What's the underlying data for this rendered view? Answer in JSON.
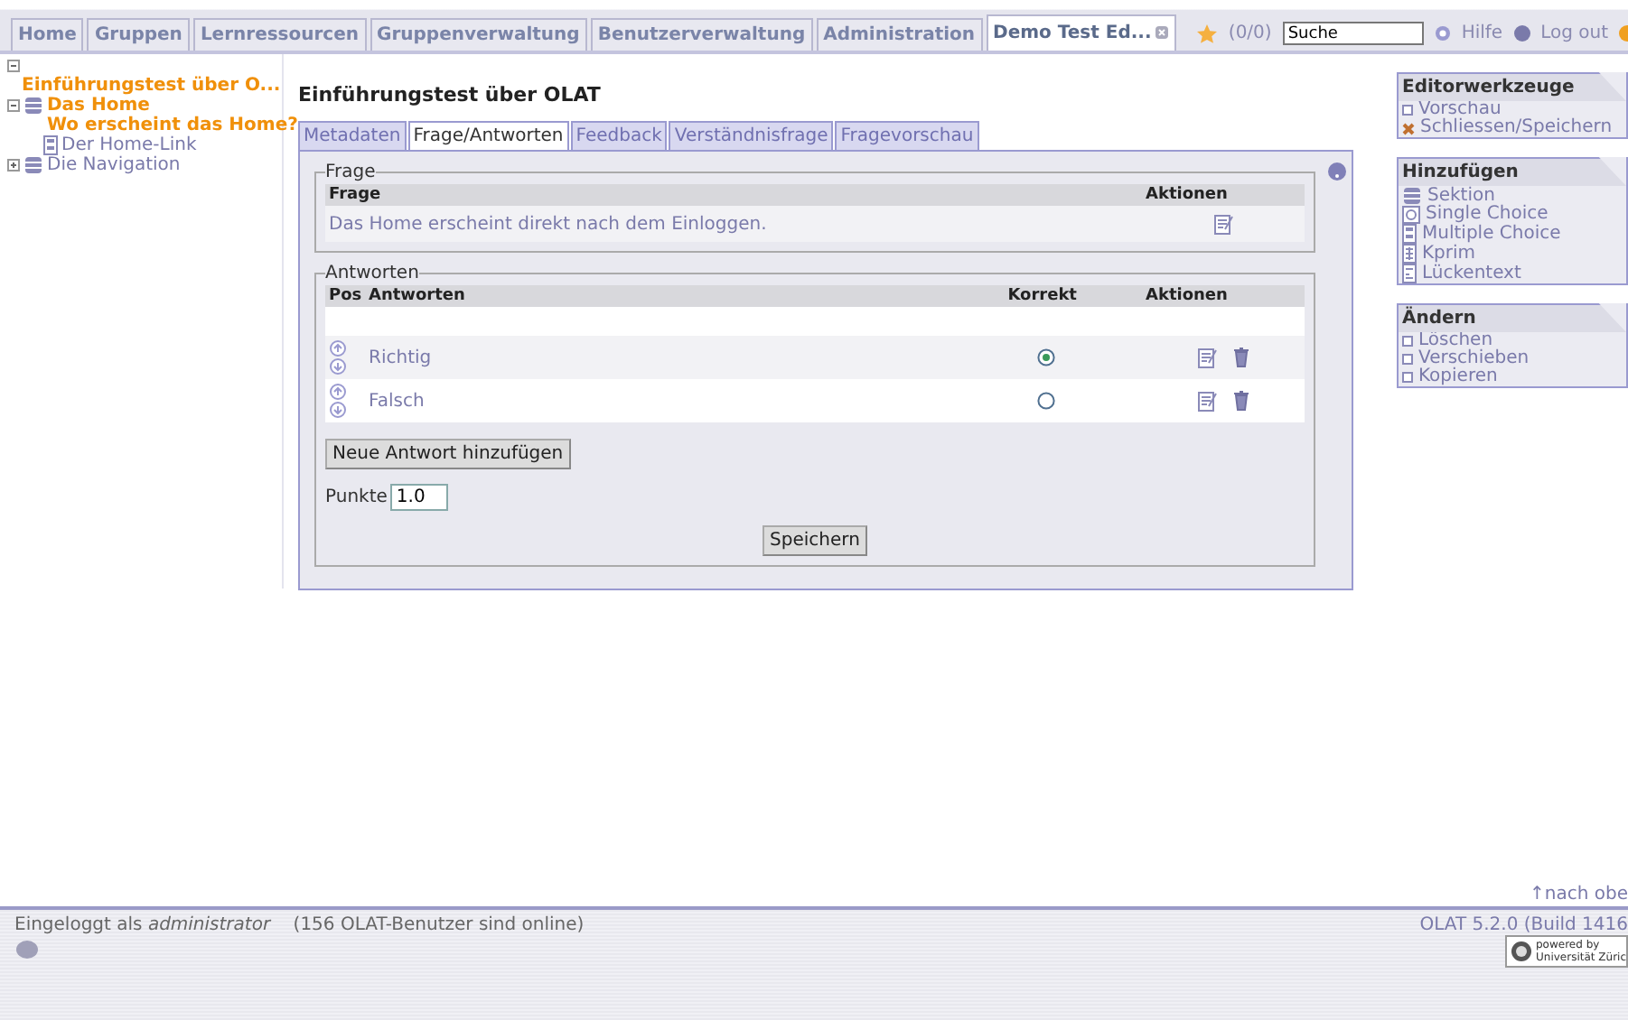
{
  "nav_tabs": [
    {
      "label": "Home",
      "selected": false
    },
    {
      "label": "Gruppen",
      "selected": false
    },
    {
      "label": "Lernressourcen",
      "selected": false
    },
    {
      "label": "Gruppenverwaltung",
      "selected": false
    },
    {
      "label": "Benutzerverwaltung",
      "selected": false
    },
    {
      "label": "Administration",
      "selected": false
    },
    {
      "label": "Demo Test Ed...",
      "selected": true,
      "closable": true
    }
  ],
  "top_tools": {
    "bookmarks": "(0/0)",
    "search": {
      "value": "Suche"
    },
    "help": "Hilfe",
    "logout": "Log out"
  },
  "tree": {
    "label": "Einführungstest über O...",
    "expanded": true,
    "children": [
      {
        "label": "Das Home",
        "kind": "section",
        "selected": false,
        "expanded": true,
        "children": [
          {
            "label": "Wo erscheint das Home?",
            "kind": "single",
            "selected": true
          },
          {
            "label": "Der Home-Link",
            "kind": "multiple",
            "selected": false
          }
        ]
      },
      {
        "label": "Die Navigation",
        "kind": "section",
        "selected": false,
        "expanded": false
      }
    ]
  },
  "main": {
    "title": "Einführungstest über OLAT",
    "tabs": [
      {
        "label": "Metadaten",
        "selected": false
      },
      {
        "label": "Frage/Antworten",
        "selected": true
      },
      {
        "label": "Feedback",
        "selected": false
      },
      {
        "label": "Verständnisfrage",
        "selected": false
      },
      {
        "label": "Fragevorschau",
        "selected": false
      }
    ],
    "question": {
      "legend": "Frage",
      "columns": [
        "Frage",
        "Aktionen"
      ],
      "text": "Das Home erscheint direkt nach dem Einloggen."
    },
    "answers": {
      "legend": "Antworten",
      "columns": [
        "Pos",
        "Antworten",
        "Korrekt",
        "Aktionen"
      ],
      "rows": [
        {
          "text": "Richtig",
          "correct": true
        },
        {
          "text": "Falsch",
          "correct": false
        }
      ]
    },
    "add_button": "Neue Antwort hinzufügen",
    "points_label": "Punkte",
    "points_value": "1.0",
    "save_button": "Speichern"
  },
  "sidebar": [
    {
      "title": "Editorwerkzeuge",
      "items": [
        {
          "label": "Vorschau",
          "kind": "bullet"
        },
        {
          "label": "Schliessen/Speichern",
          "kind": "close"
        }
      ]
    },
    {
      "title": "Hinzufügen",
      "items": [
        {
          "label": "Sektion",
          "kind": "section"
        },
        {
          "label": "Single Choice",
          "kind": "single"
        },
        {
          "label": "Multiple Choice",
          "kind": "multiple"
        },
        {
          "label": "Kprim",
          "kind": "kprim"
        },
        {
          "label": "Lückentext",
          "kind": "gap"
        }
      ]
    },
    {
      "title": "Ändern",
      "items": [
        {
          "label": "Löschen",
          "kind": "bullet"
        },
        {
          "label": "Verschieben",
          "kind": "bullet"
        },
        {
          "label": "Kopieren",
          "kind": "bullet"
        }
      ]
    }
  ],
  "to_top": "↑nach obe",
  "footer": {
    "logged_in_prefix": "Eingeloggt als",
    "user": "administrator",
    "online": "(156 OLAT-Benutzer sind online)",
    "version": "OLAT 5.2.0 (Build 1416",
    "powered_line1": "powered by",
    "powered_line2": "Universität Züric"
  }
}
